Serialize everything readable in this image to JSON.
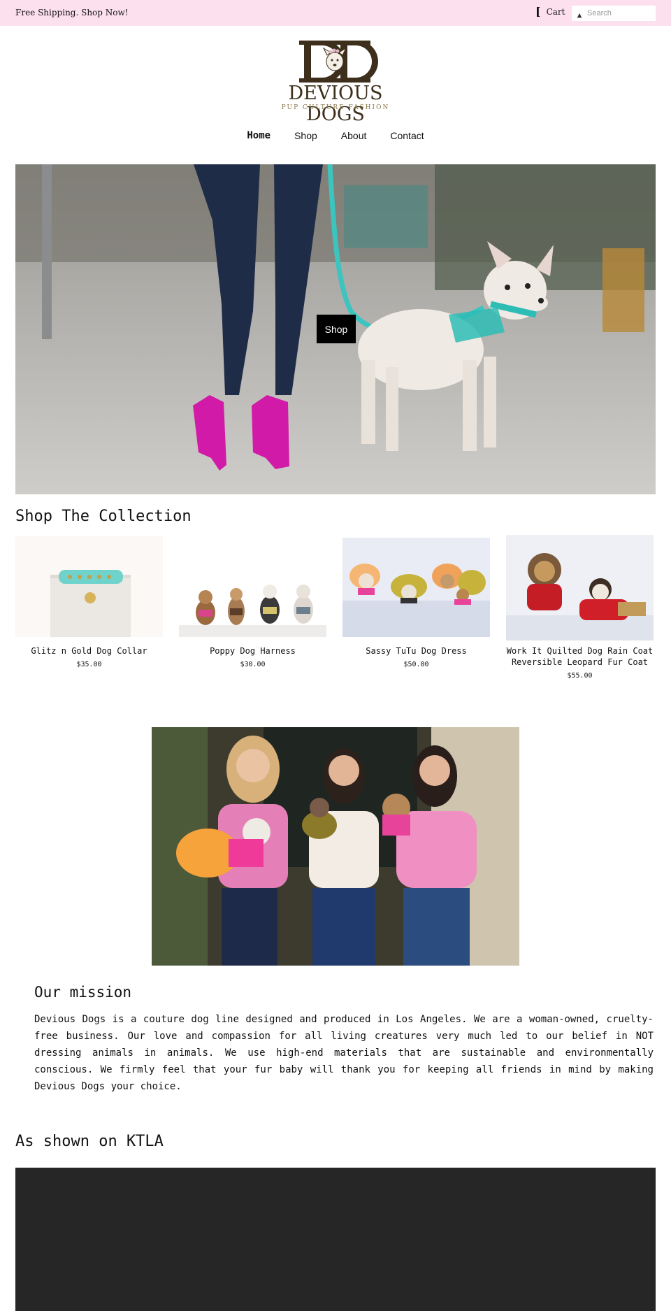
{
  "announcement": {
    "text": "Free Shipping. Shop Now!"
  },
  "header": {
    "cart_label": "Cart",
    "search_placeholder": "Search",
    "logo": {
      "name": "DEVIOUS DOGS",
      "tagline": "PUP CULTURE FASHION",
      "monogram": "DD"
    }
  },
  "nav": {
    "items": [
      {
        "label": "Home",
        "active": true
      },
      {
        "label": "Shop",
        "active": false
      },
      {
        "label": "About",
        "active": false
      },
      {
        "label": "Contact",
        "active": false
      }
    ]
  },
  "hero": {
    "button_label": "Shop"
  },
  "collection": {
    "title": "Shop The Collection",
    "products": [
      {
        "name": "Glitz n Gold Dog Collar",
        "price": "$35.00"
      },
      {
        "name": "Poppy Dog Harness",
        "price": "$30.00"
      },
      {
        "name": "Sassy TuTu Dog Dress",
        "price": "$50.00"
      },
      {
        "name": "Work It Quilted Dog Rain Coat Reversible Leopard Fur Coat",
        "price": "$55.00"
      }
    ]
  },
  "mission": {
    "title": "Our mission",
    "text": "Devious Dogs is a couture dog line designed and produced in Los Angeles. We are a woman-owned, cruelty-free business. Our love and compassion for all living creatures very much led to our belief in NOT dressing animals in animals. We use high-end materials that are sustainable and environmentally conscious. We firmly feel that your fur baby will thank you for keeping all friends in mind by making Devious Dogs your choice."
  },
  "ktla": {
    "title": "As shown on KTLA"
  },
  "colors": {
    "announcement_bg": "#fde0ee",
    "logo_brown": "#3d2f1c",
    "tagline_gold": "#8a7a4a",
    "button_bg": "#000000",
    "video_bg": "#262626"
  }
}
